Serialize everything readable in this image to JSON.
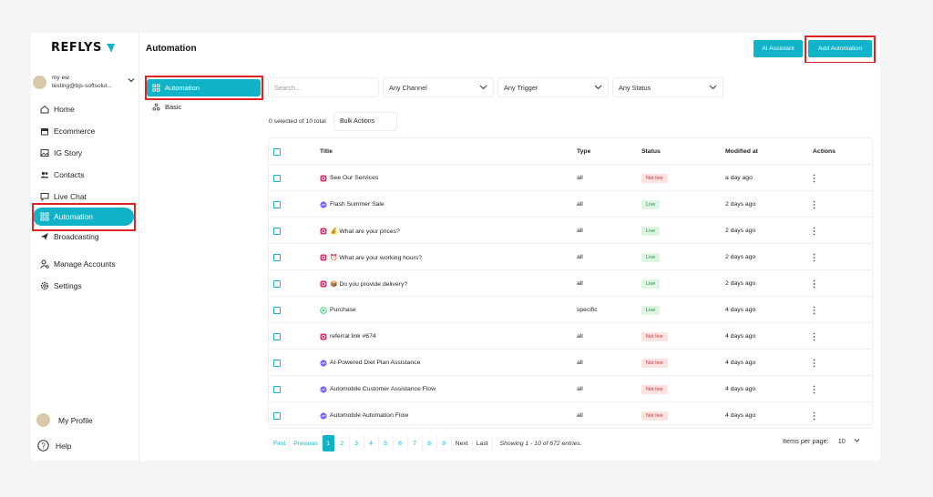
{
  "app": {
    "logo": "REFLYS"
  },
  "account": {
    "name": "my ew",
    "email": "testing@bjs-softsolut..."
  },
  "sidebar": {
    "items": [
      {
        "label": "Home",
        "icon": "home-icon"
      },
      {
        "label": "Ecommerce",
        "icon": "store-icon"
      },
      {
        "label": "IG Story",
        "icon": "image-icon"
      },
      {
        "label": "Contacts",
        "icon": "users-icon"
      },
      {
        "label": "Live Chat",
        "icon": "chat-icon"
      },
      {
        "label": "Automation",
        "icon": "automation-icon",
        "active": true
      },
      {
        "label": "Broadcasting",
        "icon": "send-icon"
      },
      {
        "label": "Manage Accounts",
        "icon": "user-settings-icon"
      },
      {
        "label": "Settings",
        "icon": "gear-icon"
      }
    ],
    "profile": "My Profile",
    "help": "Help"
  },
  "header": {
    "title": "Automation",
    "ai_button": "AI Assistant",
    "add_button": "Add Automation"
  },
  "subnav": {
    "active": "Automation",
    "basic": "Basic"
  },
  "filters": {
    "search_placeholder": "Search...",
    "channel": "Any Channel",
    "trigger": "Any Trigger",
    "status": "Any Status"
  },
  "selection": {
    "text": "0 selected of 10 total",
    "bulk": "Bulk Actions"
  },
  "table": {
    "headers": {
      "title": "Title",
      "type": "Type",
      "status": "Status",
      "modified": "Modified at",
      "actions": "Actions"
    },
    "rows": [
      {
        "title": "See Our Services",
        "channel": "instagram",
        "type": "all",
        "status": "Not live",
        "modified": "a day ago"
      },
      {
        "title": "Flash Summer Sale",
        "channel": "messenger",
        "type": "all",
        "status": "Live",
        "modified": "2 days ago"
      },
      {
        "title": "💰 What are your prices?",
        "channel": "instagram",
        "type": "all",
        "status": "Live",
        "modified": "2 days ago"
      },
      {
        "title": "⏰ What are your working hours?",
        "channel": "instagram",
        "type": "all",
        "status": "Live",
        "modified": "2 days ago"
      },
      {
        "title": "📦 Do you provide delivery?",
        "channel": "instagram",
        "type": "all",
        "status": "Live",
        "modified": "2 days ago"
      },
      {
        "title": "Purchase",
        "channel": "whatsapp",
        "type": "specific",
        "status": "Live",
        "modified": "4 days ago"
      },
      {
        "title": "referral link #674",
        "channel": "instagram",
        "type": "all",
        "status": "Not live",
        "modified": "4 days ago"
      },
      {
        "title": "AI-Powered Diet Plan Assistance",
        "channel": "messenger",
        "type": "all",
        "status": "Not live",
        "modified": "4 days ago"
      },
      {
        "title": "Automobile Customer Assistance Flow",
        "channel": "messenger",
        "type": "all",
        "status": "Not live",
        "modified": "4 days ago"
      },
      {
        "title": "Automobile Automation Flow",
        "channel": "messenger",
        "type": "all",
        "status": "Not live",
        "modified": "4 days ago"
      }
    ]
  },
  "pagination": {
    "first": "First",
    "previous": "Previous",
    "pages": [
      "1",
      "2",
      "3",
      "4",
      "5",
      "6",
      "7",
      "8",
      "9"
    ],
    "current": "1",
    "next": "Next",
    "last": "Last",
    "showing": "Showing 1 - 10 of 672 entries.",
    "items_per_page_label": "Items per page:",
    "items_per_page": "10"
  },
  "colors": {
    "accent": "#10b3c8",
    "highlight": "#e02424",
    "live": "#1d8a3a",
    "not_live": "#c9302c"
  }
}
